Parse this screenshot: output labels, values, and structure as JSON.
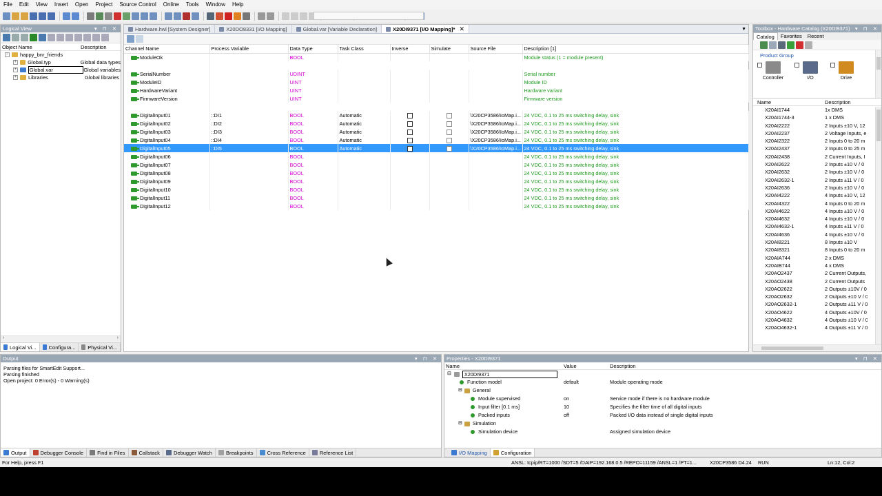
{
  "menu": [
    "File",
    "Edit",
    "View",
    "Insert",
    "Open",
    "Project",
    "Source Control",
    "Online",
    "Tools",
    "Window",
    "Help"
  ],
  "logical_view": {
    "title": "Logical View",
    "col_object": "Object Name",
    "col_desc": "Description",
    "items": [
      {
        "name": "happy_bnr_friends",
        "desc": ""
      },
      {
        "name": "Global.typ",
        "desc": "Global data types"
      },
      {
        "name": "Global.var",
        "desc": "Global variables"
      },
      {
        "name": "Libraries",
        "desc": "Global libraries"
      }
    ],
    "bottom_tabs": [
      "Logical Vi...",
      "Configura...",
      "Physical Vi..."
    ]
  },
  "editor": {
    "tabs": [
      {
        "label": "Hardware.hwl [System Designer]"
      },
      {
        "label": "X20DO8331 [I/O Mapping]"
      },
      {
        "label": "Global.var [Variable Declaration]"
      },
      {
        "label": "X20DI9371 [I/O Mapping]*"
      }
    ],
    "columns": [
      "Channel Name",
      "Process Variable",
      "Data Type",
      "Task Class",
      "Inverse",
      "Simulate",
      "Source File",
      "Description [1]"
    ],
    "rows_top": [
      {
        "name": "ModuleOk",
        "pv": "",
        "dt": "BOOL",
        "desc": "Module status (1 = module present)"
      },
      {
        "name": "SerialNumber",
        "pv": "",
        "dt": "UDINT",
        "desc": "Serial number"
      },
      {
        "name": "ModuleID",
        "pv": "",
        "dt": "UINT",
        "desc": "Module ID"
      },
      {
        "name": "HardwareVariant",
        "pv": "",
        "dt": "UINT",
        "desc": "Hardware variant"
      },
      {
        "name": "FirmwareVersion",
        "pv": "",
        "dt": "UINT",
        "desc": "Firmware version"
      }
    ],
    "rows_io": [
      {
        "name": "DigitalInput01",
        "pv": "::DI1",
        "dt": "BOOL",
        "tc": "Automatic",
        "src": "\\X20CP3586\\IoMap.i...",
        "desc": "24 VDC, 0.1 to 25 ms switching delay, sink",
        "inv": true,
        "sim": true
      },
      {
        "name": "DigitalInput02",
        "pv": "::DI2",
        "dt": "BOOL",
        "tc": "Automatic",
        "src": "\\X20CP3586\\IoMap.i...",
        "desc": "24 VDC, 0.1 to 25 ms switching delay, sink",
        "inv": true,
        "sim": true
      },
      {
        "name": "DigitalInput03",
        "pv": "::DI3",
        "dt": "BOOL",
        "tc": "Automatic",
        "src": "\\X20CP3586\\IoMap.i...",
        "desc": "24 VDC, 0.1 to 25 ms switching delay, sink",
        "inv": true,
        "sim": true
      },
      {
        "name": "DigitalInput04",
        "pv": "::DI4",
        "dt": "BOOL",
        "tc": "Automatic",
        "src": "\\X20CP3586\\IoMap.i...",
        "desc": "24 VDC, 0.1 to 25 ms switching delay, sink",
        "inv": true,
        "sim": true
      },
      {
        "name": "DigitalInput05",
        "pv": "::DI5",
        "dt": "BOOL",
        "tc": "Automatic",
        "src": "\\X20CP3586\\IoMap.i...",
        "desc": "24 VDC, 0.1 to 25 ms switching delay, sink",
        "inv": true,
        "sim": true
      },
      {
        "name": "DigitalInput06",
        "pv": "",
        "dt": "BOOL",
        "tc": "",
        "src": "",
        "desc": "24 VDC, 0.1 to 25 ms switching delay, sink"
      },
      {
        "name": "DigitalInput07",
        "pv": "",
        "dt": "BOOL",
        "tc": "",
        "src": "",
        "desc": "24 VDC, 0.1 to 25 ms switching delay, sink"
      },
      {
        "name": "DigitalInput08",
        "pv": "",
        "dt": "BOOL",
        "tc": "",
        "src": "",
        "desc": "24 VDC, 0.1 to 25 ms switching delay, sink"
      },
      {
        "name": "DigitalInput09",
        "pv": "",
        "dt": "BOOL",
        "tc": "",
        "src": "",
        "desc": "24 VDC, 0.1 to 25 ms switching delay, sink"
      },
      {
        "name": "DigitalInput10",
        "pv": "",
        "dt": "BOOL",
        "tc": "",
        "src": "",
        "desc": "24 VDC, 0.1 to 25 ms switching delay, sink"
      },
      {
        "name": "DigitalInput11",
        "pv": "",
        "dt": "BOOL",
        "tc": "",
        "src": "",
        "desc": "24 VDC, 0.1 to 25 ms switching delay, sink"
      },
      {
        "name": "DigitalInput12",
        "pv": "",
        "dt": "BOOL",
        "tc": "",
        "src": "",
        "desc": "24 VDC, 0.1 to 25 ms switching delay, sink"
      }
    ]
  },
  "toolbox": {
    "title": "Toolbox - Hardware Catalog (X20DI9371)",
    "tabs": [
      "Catalog",
      "Favorites",
      "Recent"
    ],
    "product_group_label": "Product Group",
    "groups": [
      "Controller",
      "I/O",
      "Drive"
    ],
    "col_name": "Name",
    "col_desc": "Description",
    "items": [
      {
        "n": "X20AI1744",
        "d": "1x DMS"
      },
      {
        "n": "X20AI1744-3",
        "d": "1 x DMS"
      },
      {
        "n": "X20AI2222",
        "d": "2 Inputs ±10 V, 12"
      },
      {
        "n": "X20AI2237",
        "d": "2 Voltage Inputs, e"
      },
      {
        "n": "X20AI2322",
        "d": "2 Inputs 0 to 20 m"
      },
      {
        "n": "X20AI2437",
        "d": "2 Inputs 0 to 25 m"
      },
      {
        "n": "X20AI2438",
        "d": "2 Current Inputs, I"
      },
      {
        "n": "X20AI2622",
        "d": "2 Inputs ±10 V / 0"
      },
      {
        "n": "X20AI2632",
        "d": "2 Inputs ±10 V / 0"
      },
      {
        "n": "X20AI2632-1",
        "d": "2 Inputs ±11 V / 0"
      },
      {
        "n": "X20AI2636",
        "d": "2 Inputs ±10 V / 0"
      },
      {
        "n": "X20AI4222",
        "d": "4 Inputs ±10 V, 12"
      },
      {
        "n": "X20AI4322",
        "d": "4 Inputs 0 to 20 m"
      },
      {
        "n": "X20AI4622",
        "d": "4 Inputs ±10 V / 0"
      },
      {
        "n": "X20AI4632",
        "d": "4 Inputs ±10 V / 0"
      },
      {
        "n": "X20AI4632-1",
        "d": "4 Inputs ±11 V / 0"
      },
      {
        "n": "X20AI4636",
        "d": "4 Inputs ±10 V / 0"
      },
      {
        "n": "X20AI8221",
        "d": "8 Inputs ±10 V"
      },
      {
        "n": "X20AI8321",
        "d": "8 Inputs 0 to 20 m"
      },
      {
        "n": "X20AIA744",
        "d": "2 x DMS"
      },
      {
        "n": "X20AIB744",
        "d": "4 x DMS"
      },
      {
        "n": "X20AO2437",
        "d": "2 Current Outputs,"
      },
      {
        "n": "X20AO2438",
        "d": "2 Current Outputs"
      },
      {
        "n": "X20AO2622",
        "d": "2 Outputs ±10V / 0"
      },
      {
        "n": "X20AO2632",
        "d": "2 Outputs ±10 V / 0"
      },
      {
        "n": "X20AO2632-1",
        "d": "2 Outputs ±11 V / 0"
      },
      {
        "n": "X20AO4622",
        "d": "4 Outputs ±10V / 0"
      },
      {
        "n": "X20AO4632",
        "d": "4 Outputs ±10 V / 0"
      },
      {
        "n": "X20AO4632-1",
        "d": "4 Outputs ±11 V / 0"
      }
    ]
  },
  "output": {
    "title": "Output",
    "lines": [
      "Parsing files for SmartEdit Support...",
      "Parsing finished",
      "Open project: 0 Error(s) - 0 Warning(s)"
    ],
    "tabs": [
      "Output",
      "Debugger Console",
      "Find in Files",
      "Callstack",
      "Debugger Watch",
      "Breakpoints",
      "Cross Reference",
      "Reference List"
    ]
  },
  "properties": {
    "title": "Properties - X20DI9371",
    "cols": [
      "Name",
      "Value",
      "Description"
    ],
    "root": "X20DI9371",
    "rows": [
      {
        "name": "Function model",
        "value": "default",
        "desc": "Module operating mode",
        "level": 1,
        "kind": "leaf"
      },
      {
        "name": "General",
        "value": "",
        "desc": "",
        "level": 1,
        "kind": "group"
      },
      {
        "name": "Module supervised",
        "value": "on",
        "desc": "Service mode if there is no hardware module",
        "level": 2,
        "kind": "leaf"
      },
      {
        "name": "Input filter [0.1 ms]",
        "value": "10",
        "desc": "Specifies the filter time of all digital inputs",
        "level": 2,
        "kind": "leaf"
      },
      {
        "name": "Packed inputs",
        "value": "off",
        "desc": "Packed I/O data instead of single digital inputs",
        "level": 2,
        "kind": "leaf"
      },
      {
        "name": "Simulation",
        "value": "",
        "desc": "",
        "level": 1,
        "kind": "group"
      },
      {
        "name": "Simulation device",
        "value": "",
        "desc": "Assigned simulation device",
        "level": 2,
        "kind": "leaf"
      }
    ],
    "tabs": [
      "I/O Mapping",
      "Configuration"
    ]
  },
  "status": {
    "help": "For Help, press F1",
    "connection": "ANSL: tcpip/RT=1000 /SDT=5 /DAIP=192.168.0.5 /REPO=11159 /ANSL=1 /PT=1...",
    "cpu": "X20CP3586 D4.24",
    "mode": "RUN",
    "pos": "Ln:12, Col:2"
  }
}
